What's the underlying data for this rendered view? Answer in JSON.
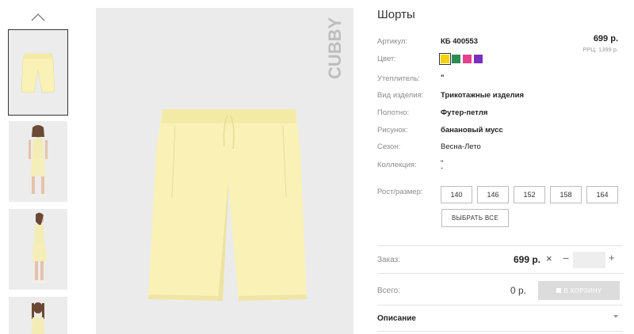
{
  "product": {
    "title": "Шорты",
    "price": "699 р.",
    "rrp": "РРЦ: 1399 р."
  },
  "specs": {
    "article_label": "Артикул:",
    "article_value": "КБ 400553",
    "color_label": "Цвет:",
    "insulation_label": "Утеплитель:",
    "insulation_value": "\"",
    "type_label": "Вид изделия:",
    "type_value": "Трикотажные изделия",
    "fabric_label": "Полотно:",
    "fabric_value": "Футер-петля",
    "pattern_label": "Рисунок:",
    "pattern_value": "банановый мусс",
    "season_label": "Сезон:",
    "season_value": "Весна-Лето",
    "collection_label": "Коллекция:",
    "collection_value_1": "\"",
    "collection_value_2": "-",
    "size_label": "Рост/размер:"
  },
  "colors": [
    "#f6d200",
    "#2e8b57",
    "#e83e8c",
    "#7b2fbf"
  ],
  "sizes": [
    "140",
    "146",
    "152",
    "158",
    "164"
  ],
  "select_all_label": "ВЫБРАТЬ ВСЕ",
  "order": {
    "label": "Заказ:",
    "price": "699 р.",
    "remove": "×",
    "minus": "−",
    "plus": "+",
    "qty": ""
  },
  "total": {
    "label": "Всего:",
    "value": "0 р.",
    "cart_button": "В КОРЗИНУ"
  },
  "description_label": "Описание",
  "brand": "CUBBY",
  "accent": {
    "shorts": "#f9f1b6",
    "shorts_shadow": "#ece3a0",
    "image_bg": "#ebebeb"
  },
  "icons": {
    "thumb_up": "chevron-up-icon",
    "cart": "cart-icon",
    "desc_arrow": "caret-down-icon"
  }
}
